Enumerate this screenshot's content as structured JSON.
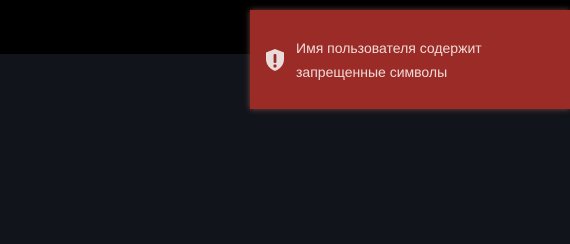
{
  "toast": {
    "message": "Имя пользователя содержит запрещенные символы",
    "icon": "shield-exclamation-icon",
    "colors": {
      "background": "#9b2b27",
      "text": "#f0d9d6"
    }
  }
}
